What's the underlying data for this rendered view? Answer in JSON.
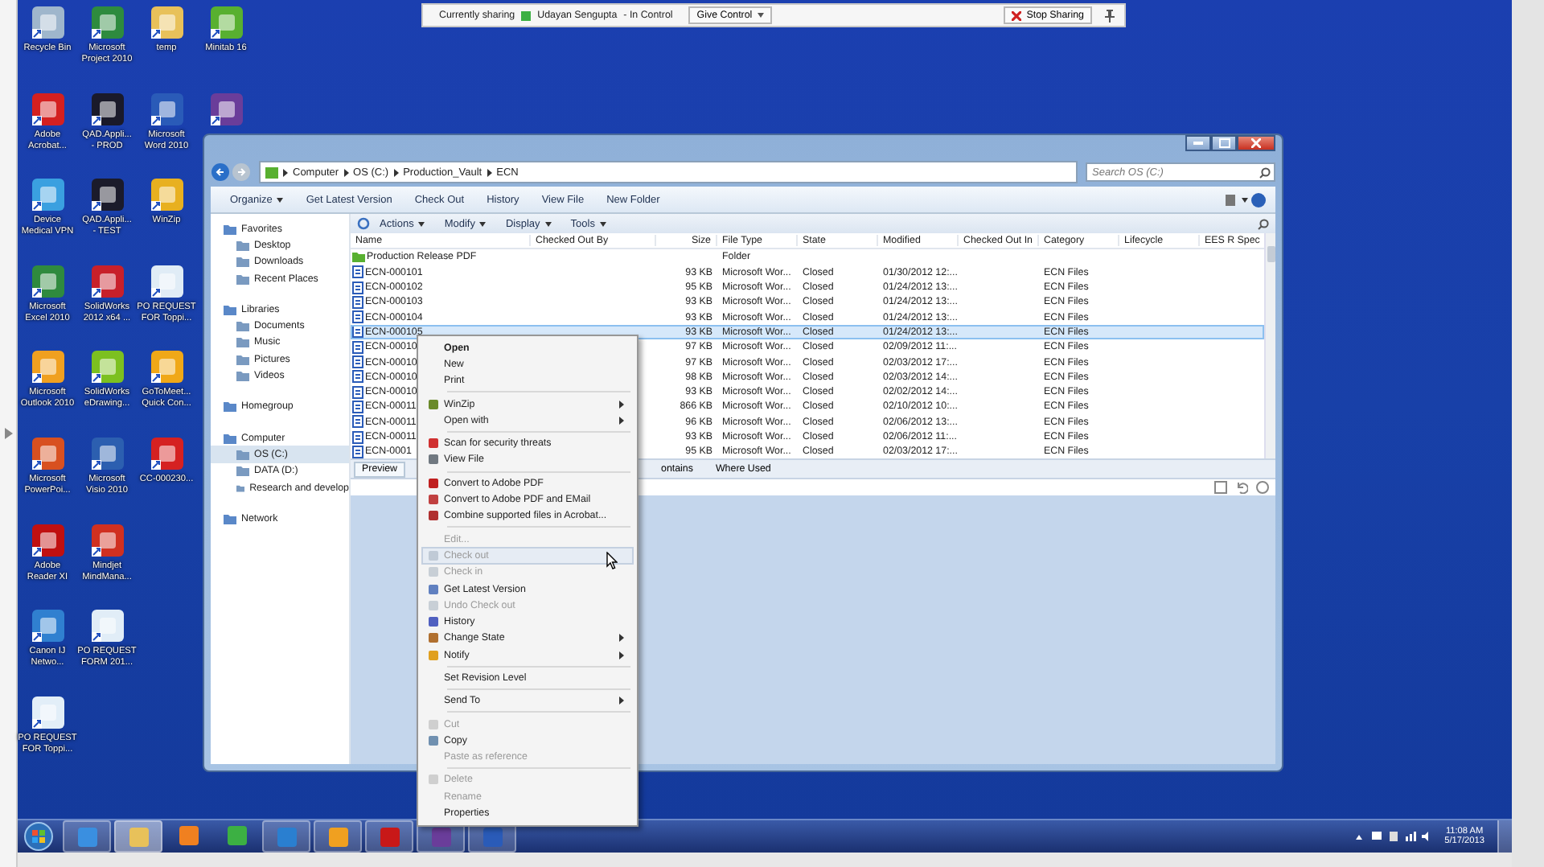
{
  "sharing_bar": {
    "status": "Currently sharing",
    "presenter": "Udayan Sengupta",
    "role": "- In Control",
    "give_control": "Give Control",
    "stop_sharing": "Stop Sharing"
  },
  "desktop_icons": [
    [
      {
        "label": "Recycle Bin",
        "color": "#9fb6cc"
      },
      {
        "label": "Microsoft\nProject 2010",
        "color": "#2e8b3e"
      },
      {
        "label": "temp",
        "color": "#e8c15a"
      },
      {
        "label": "Minitab 16",
        "color": "#58b030"
      }
    ],
    [
      {
        "label": "Adobe\nAcrobat...",
        "color": "#d42020"
      },
      {
        "label": "QAD.Appli...\n- PROD",
        "color": "#1a1a2a"
      },
      {
        "label": "Microsoft\nWord 2010",
        "color": "#2a5bb8"
      },
      {
        "color": "#6a3d9a"
      }
    ],
    [
      {
        "label": "Device\nMedical VPN",
        "color": "#3aa0e0"
      },
      {
        "label": "QAD.Appli...\n- TEST",
        "color": "#1b1b2b"
      },
      {
        "label": "WinZip",
        "color": "#e8b020"
      }
    ],
    [
      {
        "label": "Microsoft\nExcel 2010",
        "color": "#2f8a3e"
      },
      {
        "label": "SolidWorks\n2012 x64 ...",
        "color": "#c8202a"
      },
      {
        "label": "PO REQUEST\nFOR Toppi...",
        "color": "#e0ecf6"
      }
    ],
    [
      {
        "label": "Microsoft\nOutlook 2010",
        "color": "#f0a020"
      },
      {
        "label": "SolidWorks\neDrawing...",
        "color": "#7cc020"
      },
      {
        "label": "GoToMeet...\nQuick Con...",
        "color": "#f0a818"
      }
    ],
    [
      {
        "label": "Microsoft\nPowerPoi...",
        "color": "#d85020"
      },
      {
        "label": "Microsoft\nVisio 2010",
        "color": "#2c5fb0"
      },
      {
        "label": "CC-000230...",
        "color": "#d52121"
      }
    ],
    [
      {
        "label": "Adobe\nReader XI",
        "color": "#c01010"
      },
      {
        "label": "Mindjet\nMindMana...",
        "color": "#d03020"
      }
    ],
    [
      {
        "label": "Canon IJ\nNetwo...",
        "color": "#3080d0"
      },
      {
        "label": "PO REQUEST\nFORM 201...",
        "color": "#e1edf7"
      }
    ],
    [
      {
        "label": "PO REQUEST\nFOR Toppi...",
        "color": "#e2eef8"
      }
    ]
  ],
  "explorer": {
    "address": [
      "Computer",
      "OS (C:)",
      "Production_Vault",
      "ECN"
    ],
    "search": {
      "placeholder": "Search OS (C:)"
    },
    "toolbar": [
      {
        "label": "Organize",
        "dropdown": true
      },
      {
        "label": "Get Latest Version",
        "dropdown": false
      },
      {
        "label": "Check Out",
        "dropdown": false
      },
      {
        "label": "History",
        "dropdown": false
      },
      {
        "label": "View File",
        "dropdown": false
      },
      {
        "label": "New Folder",
        "dropdown": false
      }
    ],
    "nav": [
      {
        "label": "Favorites",
        "selected": false,
        "children": [
          {
            "label": "Desktop",
            "selected": false
          },
          {
            "label": "Downloads",
            "selected": false
          },
          {
            "label": "Recent Places",
            "selected": false
          }
        ]
      },
      {
        "label": "Libraries",
        "selected": false,
        "children": [
          {
            "label": "Documents",
            "selected": false
          },
          {
            "label": "Music",
            "selected": false
          },
          {
            "label": "Pictures",
            "selected": false
          },
          {
            "label": "Videos",
            "selected": false
          }
        ]
      },
      {
        "label": "Homegroup",
        "selected": false
      },
      {
        "label": "Computer",
        "selected": false,
        "children": [
          {
            "label": "OS (C:)",
            "selected": true
          },
          {
            "label": "DATA (D:)",
            "selected": false
          },
          {
            "label": "Research and develop",
            "selected": false
          }
        ]
      },
      {
        "label": "Network",
        "selected": false
      }
    ],
    "list_toolbar": [
      {
        "label": "Actions"
      },
      {
        "label": "Modify"
      },
      {
        "label": "Display"
      },
      {
        "label": "Tools"
      }
    ],
    "columns": [
      "Name",
      "Checked Out By",
      "Size",
      "File Type",
      "State",
      "Modified",
      "Checked Out In",
      "Category",
      "Lifecycle",
      "EES R Spec"
    ],
    "rows": [
      {
        "kind": "folder",
        "name": "Production Release PDF",
        "size": "",
        "type": "Folder",
        "state": "",
        "modified": "",
        "category": "",
        "selected": false
      },
      {
        "kind": "file",
        "name": "ECN-000101",
        "size": "93 KB",
        "type": "Microsoft Wor...",
        "state": "Closed",
        "modified": "01/30/2012 12:...",
        "category": "ECN Files",
        "selected": false
      },
      {
        "kind": "file",
        "name": "ECN-000102",
        "size": "95 KB",
        "type": "Microsoft Wor...",
        "state": "Closed",
        "modified": "01/24/2012 13:...",
        "category": "ECN Files",
        "selected": false
      },
      {
        "kind": "file",
        "name": "ECN-000103",
        "size": "93 KB",
        "type": "Microsoft Wor...",
        "state": "Closed",
        "modified": "01/24/2012 13:...",
        "category": "ECN Files",
        "selected": false
      },
      {
        "kind": "file",
        "name": "ECN-000104",
        "size": "93 KB",
        "type": "Microsoft Wor...",
        "state": "Closed",
        "modified": "01/24/2012 13:...",
        "category": "ECN Files",
        "selected": false
      },
      {
        "kind": "file",
        "name": "ECN-000105",
        "size": "93 KB",
        "type": "Microsoft Wor...",
        "state": "Closed",
        "modified": "01/24/2012 13:...",
        "category": "ECN Files",
        "selected": true
      },
      {
        "kind": "file",
        "name": "ECN-00010",
        "size": "97 KB",
        "type": "Microsoft Wor...",
        "state": "Closed",
        "modified": "02/09/2012 11:...",
        "category": "ECN Files",
        "selected": false
      },
      {
        "kind": "file",
        "name": "ECN-00010",
        "size": "97 KB",
        "type": "Microsoft Wor...",
        "state": "Closed",
        "modified": "02/03/2012 17:...",
        "category": "ECN Files",
        "selected": false
      },
      {
        "kind": "file",
        "name": "ECN-00010",
        "size": "98 KB",
        "type": "Microsoft Wor...",
        "state": "Closed",
        "modified": "02/03/2012 14:...",
        "category": "ECN Files",
        "selected": false
      },
      {
        "kind": "file",
        "name": "ECN-00010",
        "size": "93 KB",
        "type": "Microsoft Wor...",
        "state": "Closed",
        "modified": "02/02/2012 14:...",
        "category": "ECN Files",
        "selected": false
      },
      {
        "kind": "file",
        "name": "ECN-00011",
        "size": "866 KB",
        "type": "Microsoft Wor...",
        "state": "Closed",
        "modified": "02/10/2012 10:...",
        "category": "ECN Files",
        "selected": false
      },
      {
        "kind": "file",
        "name": "ECN-00011",
        "size": "96 KB",
        "type": "Microsoft Wor...",
        "state": "Closed",
        "modified": "02/06/2012 13:...",
        "category": "ECN Files",
        "selected": false
      },
      {
        "kind": "file",
        "name": "ECN-00011",
        "size": "93 KB",
        "type": "Microsoft Wor...",
        "state": "Closed",
        "modified": "02/06/2012 11:...",
        "category": "ECN Files",
        "selected": false
      },
      {
        "kind": "file",
        "name": "ECN-0001",
        "size": "95 KB",
        "type": "Microsoft Wor...",
        "state": "Closed",
        "modified": "02/03/2012 17:...",
        "category": "ECN Files",
        "selected": false
      }
    ],
    "bottom_tabs": [
      {
        "label": "Preview",
        "selected": true
      },
      {
        "label": "ontains",
        "selected": false
      },
      {
        "label": "Where Used",
        "selected": false
      }
    ]
  },
  "context_menu": [
    {
      "kind": "item",
      "label": "Open",
      "bold": true,
      "icon": false,
      "disabled": false,
      "submenu": false,
      "highlighted": false
    },
    {
      "kind": "item",
      "label": "New",
      "bold": false,
      "icon": false,
      "disabled": false,
      "submenu": false,
      "highlighted": false
    },
    {
      "kind": "item",
      "label": "Print",
      "bold": false,
      "icon": false,
      "disabled": false,
      "submenu": false,
      "highlighted": false
    },
    {
      "kind": "separator"
    },
    {
      "kind": "item",
      "label": "WinZip",
      "bold": false,
      "icon": true,
      "disabled": false,
      "submenu": true,
      "highlighted": false
    },
    {
      "kind": "item",
      "label": "Open with",
      "bold": false,
      "icon": false,
      "disabled": false,
      "submenu": true,
      "highlighted": false
    },
    {
      "kind": "separator"
    },
    {
      "kind": "item",
      "label": "Scan for security threats",
      "bold": false,
      "icon": true,
      "disabled": false,
      "submenu": false,
      "highlighted": false
    },
    {
      "kind": "item",
      "label": "View File",
      "bold": false,
      "icon": true,
      "disabled": false,
      "submenu": false,
      "highlighted": false
    },
    {
      "kind": "separator"
    },
    {
      "kind": "item",
      "label": "Convert to Adobe PDF",
      "bold": false,
      "icon": true,
      "disabled": false,
      "submenu": false,
      "highlighted": false
    },
    {
      "kind": "item",
      "label": "Convert to Adobe PDF and EMail",
      "bold": false,
      "icon": true,
      "disabled": false,
      "submenu": false,
      "highlighted": false
    },
    {
      "kind": "item",
      "label": "Combine supported files in Acrobat...",
      "bold": false,
      "icon": true,
      "disabled": false,
      "submenu": false,
      "highlighted": false
    },
    {
      "kind": "separator"
    },
    {
      "kind": "item",
      "label": "Edit...",
      "bold": false,
      "icon": false,
      "disabled": true,
      "submenu": false,
      "highlighted": false
    },
    {
      "kind": "item",
      "label": "Check out",
      "bold": false,
      "icon": true,
      "disabled": true,
      "submenu": false,
      "highlighted": true
    },
    {
      "kind": "item",
      "label": "Check in",
      "bold": false,
      "icon": true,
      "disabled": true,
      "submenu": false,
      "highlighted": false
    },
    {
      "kind": "item",
      "label": "Get Latest Version",
      "bold": false,
      "icon": true,
      "disabled": false,
      "submenu": false,
      "highlighted": false
    },
    {
      "kind": "item",
      "label": "Undo Check out",
      "bold": false,
      "icon": true,
      "disabled": true,
      "submenu": false,
      "highlighted": false
    },
    {
      "kind": "item",
      "label": "History",
      "bold": false,
      "icon": true,
      "disabled": false,
      "submenu": false,
      "highlighted": false
    },
    {
      "kind": "item",
      "label": "Change State",
      "bold": false,
      "icon": true,
      "disabled": false,
      "submenu": true,
      "highlighted": false
    },
    {
      "kind": "item",
      "label": "Notify",
      "bold": false,
      "icon": true,
      "disabled": false,
      "submenu": true,
      "highlighted": false
    },
    {
      "kind": "separator"
    },
    {
      "kind": "item",
      "label": "Set Revision Level",
      "bold": false,
      "icon": false,
      "disabled": false,
      "submenu": false,
      "highlighted": false
    },
    {
      "kind": "separator"
    },
    {
      "kind": "item",
      "label": "Send To",
      "bold": false,
      "icon": false,
      "disabled": false,
      "submenu": true,
      "highlighted": false
    },
    {
      "kind": "separator"
    },
    {
      "kind": "item",
      "label": "Cut",
      "bold": false,
      "icon": true,
      "disabled": true,
      "submenu": false,
      "highlighted": false
    },
    {
      "kind": "item",
      "label": "Copy",
      "bold": false,
      "icon": true,
      "disabled": false,
      "submenu": false,
      "highlighted": false
    },
    {
      "kind": "item",
      "label": "Paste as reference",
      "bold": false,
      "icon": false,
      "disabled": true,
      "submenu": false,
      "highlighted": false
    },
    {
      "kind": "separator"
    },
    {
      "kind": "item",
      "label": "Delete",
      "bold": false,
      "icon": true,
      "disabled": true,
      "submenu": false,
      "highlighted": false
    },
    {
      "kind": "item",
      "label": "Rename",
      "bold": false,
      "icon": false,
      "disabled": true,
      "submenu": false,
      "highlighted": false
    },
    {
      "kind": "item",
      "label": "Properties",
      "bold": false,
      "icon": false,
      "disabled": false,
      "submenu": false,
      "highlighted": false
    }
  ],
  "taskbar": {
    "apps": [
      {
        "color": "#3a8fe0",
        "running": true,
        "selected": false
      },
      {
        "color": "#e8c15a",
        "running": true,
        "selected": true
      },
      {
        "color": "#f08020",
        "running": false,
        "selected": false
      },
      {
        "color": "#3cb043",
        "running": false,
        "selected": false
      },
      {
        "color": "#2a7fd0",
        "running": true,
        "selected": false
      },
      {
        "color": "#f0a020",
        "running": true,
        "selected": false
      },
      {
        "color": "#c81818",
        "running": true,
        "selected": false
      },
      {
        "color": "#6a3d9a",
        "running": true,
        "selected": false
      },
      {
        "color": "#2a5bb8",
        "running": true,
        "selected": false
      }
    ],
    "time": "11:08 AM",
    "date": "5/17/2013"
  }
}
